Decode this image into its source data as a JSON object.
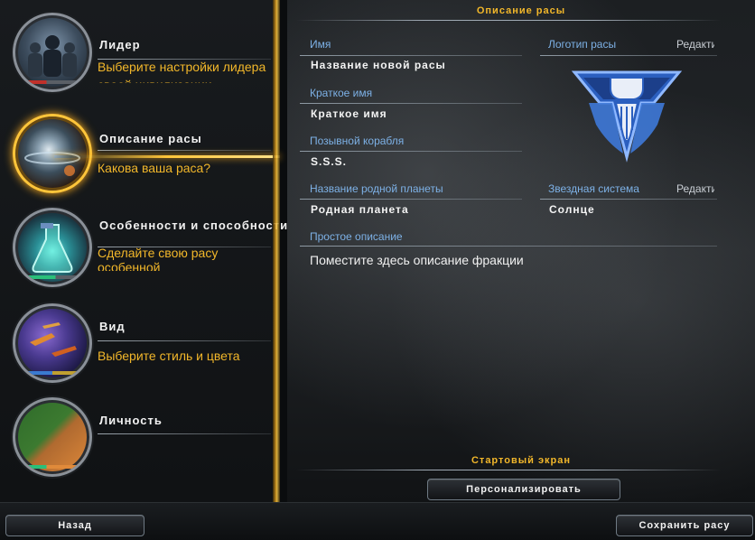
{
  "sidebar": {
    "items": [
      {
        "title": "Лидер",
        "subtitle": "Выберите настройки лидера своей цивилизации"
      },
      {
        "title": "Описание расы",
        "subtitle": "Какова ваша раса?"
      },
      {
        "title": "Особенности и способности",
        "subtitle": "Сделайте свою расу особенной"
      },
      {
        "title": "Вид",
        "subtitle": "Выберите стиль и цвета"
      },
      {
        "title": "Личность",
        "subtitle": ""
      }
    ]
  },
  "main": {
    "header": "Описание расы",
    "fields": {
      "name": {
        "label": "Имя",
        "value": "Название новой расы"
      },
      "short_name": {
        "label": "Краткое имя",
        "value": "Краткое имя"
      },
      "ship_callsign": {
        "label": "Позывной корабля",
        "value": "S.S.S."
      },
      "homeworld": {
        "label": "Название родной планеты",
        "value": "Родная планета"
      },
      "star_system": {
        "label": "Звездная система",
        "value": "Солнце",
        "edit_label": "Редактировать"
      },
      "logo": {
        "label": "Логотип расы",
        "edit_label": "Редактировать"
      },
      "description": {
        "label": "Простое описание",
        "value": "Поместите здесь описание фракции"
      }
    },
    "start_screen": {
      "header": "Стартовый экран",
      "customize_button": "Персонализировать"
    }
  },
  "footer": {
    "back_button": "Назад",
    "save_button": "Сохранить расу"
  },
  "colors": {
    "accent_gold": "#f2b72a",
    "label_blue": "#7db1e6",
    "logo_blue": "#3a6fd0"
  }
}
